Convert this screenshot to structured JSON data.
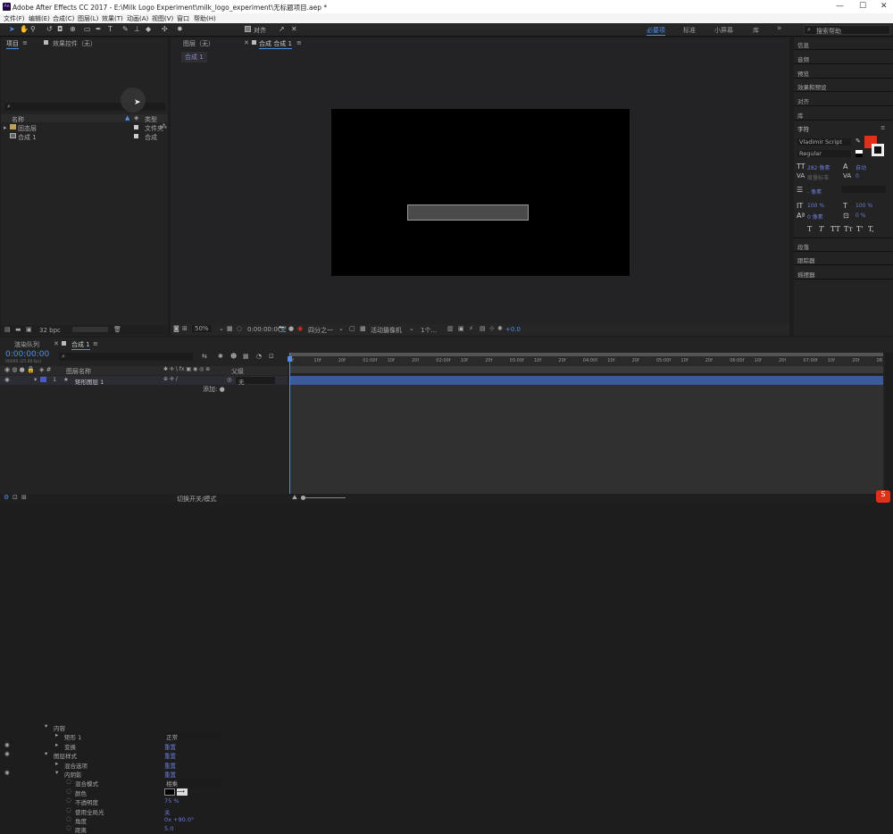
{
  "app": {
    "icon": "Ae",
    "title": "Adobe After Effects CC 2017 - E:\\Milk Logo Experiment\\milk_logo_experiment\\无标题项目.aep *",
    "window_buttons": [
      "—",
      "☐",
      "✕"
    ]
  },
  "menu": [
    "文件(F)",
    "编辑(E)",
    "合成(C)",
    "图层(L)",
    "效果(T)",
    "动画(A)",
    "视图(V)",
    "窗口",
    "帮助(H)"
  ],
  "toolbar": {
    "align_label": "对齐",
    "workspaces": [
      "必要项",
      "标准",
      "小屏幕",
      "库"
    ],
    "more": "»",
    "search_placeholder": "搜索帮助"
  },
  "project": {
    "tab": "项目",
    "tab_menu": "≡",
    "effects_tab": "效果控件（无）",
    "search_icon": "⌕",
    "columns": {
      "name": "名称",
      "type": "类型"
    },
    "items": [
      {
        "name": "固态层",
        "type": "文件夹"
      },
      {
        "name": "合成 1",
        "type": "合成"
      }
    ],
    "bpc": "32 bpc"
  },
  "viewer": {
    "layer_tab": "图层（无）",
    "comp_tab": "合成 合成 1",
    "breadcrumb": "合成 1",
    "zoom": "50%",
    "timecode": "0:00:00:00",
    "resolution": "四分之一",
    "camera": "活动摄像机",
    "views": "1个...",
    "exposure": "+0.0"
  },
  "right_panel": {
    "items": [
      "信息",
      "音频",
      "预览",
      "效果和预设",
      "对齐",
      "库"
    ],
    "char_title": "字符",
    "font": "Vladimir Script",
    "style": "Regular",
    "size": "282 像素",
    "leading": "自动",
    "kerning": "度量标准",
    "tracking": "0",
    "stroke": "- 像素",
    "vscale": "100 %",
    "hscale": "100 %",
    "baseline": "0 像素",
    "tsume": "0 %",
    "styles": [
      "T",
      "T",
      "TT",
      "Tт",
      "T'",
      "T,"
    ],
    "lower_items": [
      "段落",
      "跟踪器",
      "摇摆器"
    ]
  },
  "timeline": {
    "render_tab": "渲染队列",
    "comp_tab": "合成 1",
    "timecode": "0:00:00:00",
    "frames": "00000 (25.00 fps)",
    "search_placeholder": "⌕",
    "col_layer": "图层名称",
    "col_parent": "父级",
    "parent_value": "无",
    "layer_name": "矩形图层 1",
    "add_label": "添加: ●",
    "rows": [
      {
        "indent": 50,
        "label": "内容",
        "value": "",
        "eye": false
      },
      {
        "indent": 62,
        "label": "矩形 1",
        "value": "正常",
        "eye": false
      },
      {
        "indent": 62,
        "label": "变换",
        "value": "重置",
        "eye": true
      },
      {
        "indent": 50,
        "label": "图层样式",
        "value": "重置",
        "eye": true
      },
      {
        "indent": 62,
        "label": "混合选项",
        "value": "重置",
        "eye": false
      },
      {
        "indent": 62,
        "label": "内阴影",
        "value": "重置",
        "eye": true
      },
      {
        "indent": 74,
        "label": "混合模式",
        "value": "相乘",
        "eye": false
      },
      {
        "indent": 74,
        "label": "颜色",
        "value": "",
        "eye": false
      },
      {
        "indent": 74,
        "label": "不透明度",
        "value": "75 %",
        "eye": false
      },
      {
        "indent": 74,
        "label": "使用全局光",
        "value": "关",
        "eye": false
      },
      {
        "indent": 74,
        "label": "角度",
        "value": "0x +90.0°",
        "eye": false
      },
      {
        "indent": 74,
        "label": "距离",
        "value": "5.0",
        "eye": false
      }
    ],
    "switch_mode": "切换开关/模式",
    "ruler": [
      "0f",
      "10f",
      "20f",
      "01:00f",
      "10f",
      "20f",
      "02:00f",
      "10f",
      "20f",
      "03:00f",
      "10f",
      "20f",
      "04:00f",
      "10f",
      "20f",
      "05:00f",
      "10f",
      "20f",
      "06:00f",
      "10f",
      "20f",
      "07:00f",
      "10f",
      "20f",
      "08"
    ]
  },
  "colors": {
    "accent": "#4f8eea",
    "blue_link": "#6c7cd6",
    "swatch_red": "#e0301a",
    "title_bg": "#ffffff"
  }
}
